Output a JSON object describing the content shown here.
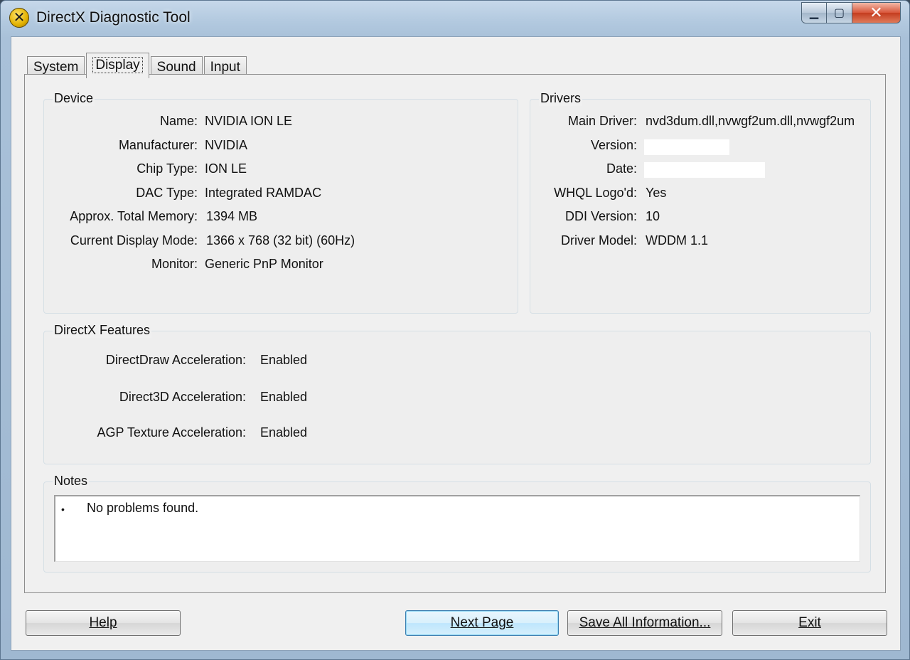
{
  "window": {
    "title": "DirectX Diagnostic Tool",
    "controls": {
      "minimize": "▁",
      "maximize": "▢",
      "close": "✕"
    }
  },
  "icons": {
    "app": "directx-icon",
    "minimize": "minimize-icon",
    "maximize": "maximize-icon",
    "close": "close-icon"
  },
  "tabs": [
    {
      "label": "System",
      "active": false
    },
    {
      "label": "Display",
      "active": true
    },
    {
      "label": "Sound",
      "active": false
    },
    {
      "label": "Input",
      "active": false
    }
  ],
  "device": {
    "title": "Device",
    "fields": [
      {
        "label": "Name:",
        "value": "NVIDIA ION LE"
      },
      {
        "label": "Manufacturer:",
        "value": "NVIDIA"
      },
      {
        "label": "Chip Type:",
        "value": "ION LE"
      },
      {
        "label": "DAC Type:",
        "value": "Integrated RAMDAC"
      },
      {
        "label": "Approx. Total Memory:",
        "value": "1394 MB"
      },
      {
        "label": "Current Display Mode:",
        "value": "1366 x 768 (32 bit) (60Hz)"
      },
      {
        "label": "Monitor:",
        "value": "Generic PnP Monitor"
      }
    ]
  },
  "drivers": {
    "title": "Drivers",
    "fields": [
      {
        "label": "Main Driver:",
        "value": "nvd3dum.dll,nvwgf2um.dll,nvwgf2um"
      },
      {
        "label": "Version:",
        "value": ""
      },
      {
        "label": "Date:",
        "value": ""
      },
      {
        "label": "WHQL Logo'd:",
        "value": "Yes"
      },
      {
        "label": "DDI Version:",
        "value": "10"
      },
      {
        "label": "Driver Model:",
        "value": "WDDM 1.1"
      }
    ]
  },
  "features": {
    "title": "DirectX Features",
    "fields": [
      {
        "label": "DirectDraw Acceleration:",
        "value": "Enabled"
      },
      {
        "label": "Direct3D Acceleration:",
        "value": "Enabled"
      },
      {
        "label": "AGP Texture Acceleration:",
        "value": "Enabled"
      }
    ]
  },
  "notes": {
    "title": "Notes",
    "bullet": "•",
    "items": [
      "No problems found."
    ]
  },
  "buttons": {
    "help": "Help",
    "next_page": "Next Page",
    "save_all": "Save All Information...",
    "exit": "Exit"
  }
}
